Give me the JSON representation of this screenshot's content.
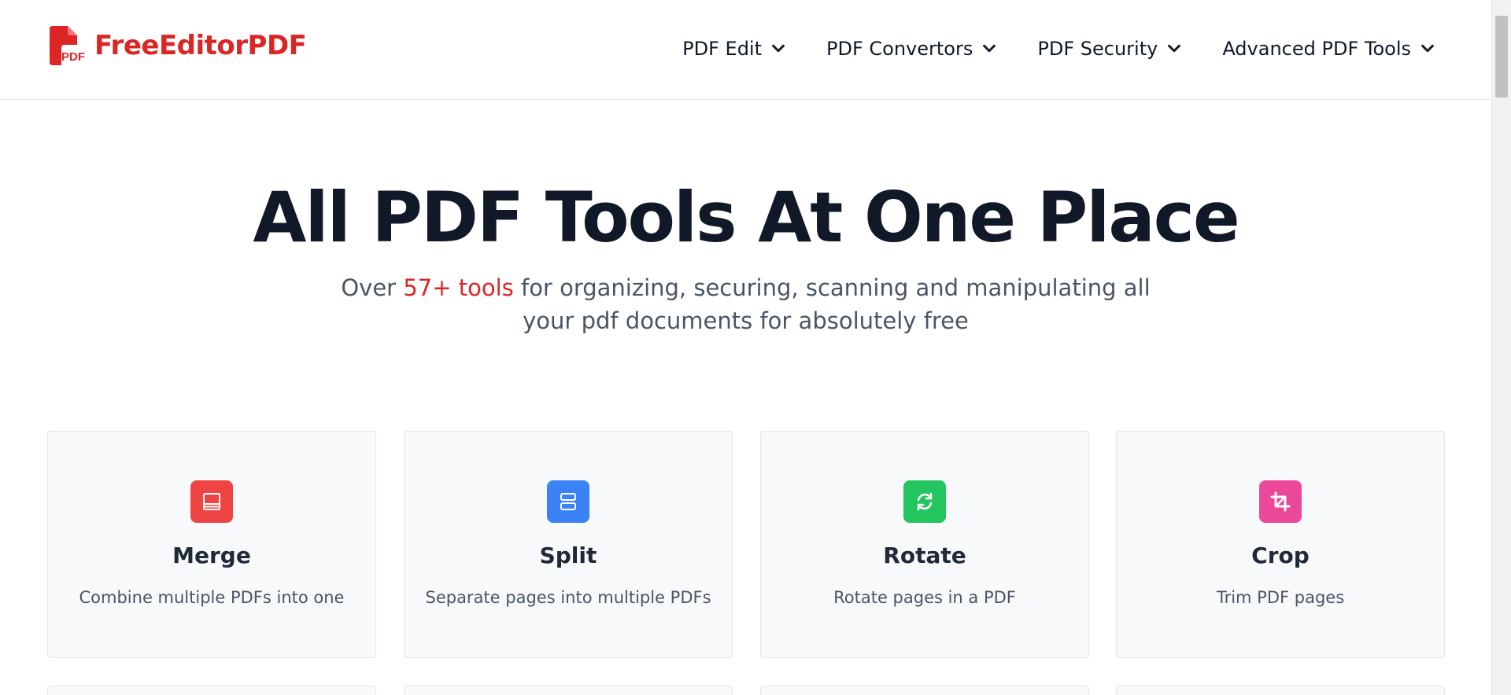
{
  "brand": {
    "name": "FreeEditorPDF",
    "icon_badge": "PDF",
    "color": "#dc2626"
  },
  "nav": [
    {
      "label": "PDF Edit",
      "icon": "chevron-down-icon"
    },
    {
      "label": "PDF Convertors",
      "icon": "chevron-down-icon"
    },
    {
      "label": "PDF Security",
      "icon": "chevron-down-icon"
    },
    {
      "label": "Advanced PDF Tools",
      "icon": "chevron-down-icon"
    }
  ],
  "hero": {
    "title": "All PDF Tools At One Place",
    "subtitle_pre": "Over ",
    "subtitle_accent": "57+ tools",
    "subtitle_post": " for organizing, securing, scanning and manipulating all your pdf documents for absolutely free"
  },
  "tools": [
    {
      "title": "Merge",
      "description": "Combine multiple PDFs into one",
      "icon": "merge-icon",
      "color": "#ef4444"
    },
    {
      "title": "Split",
      "description": "Separate pages into multiple PDFs",
      "icon": "split-icon",
      "color": "#3b82f6"
    },
    {
      "title": "Rotate",
      "description": "Rotate pages in a PDF",
      "icon": "rotate-icon",
      "color": "#22c55e"
    },
    {
      "title": "Crop",
      "description": "Trim PDF pages",
      "icon": "crop-icon",
      "color": "#ec4899"
    }
  ]
}
